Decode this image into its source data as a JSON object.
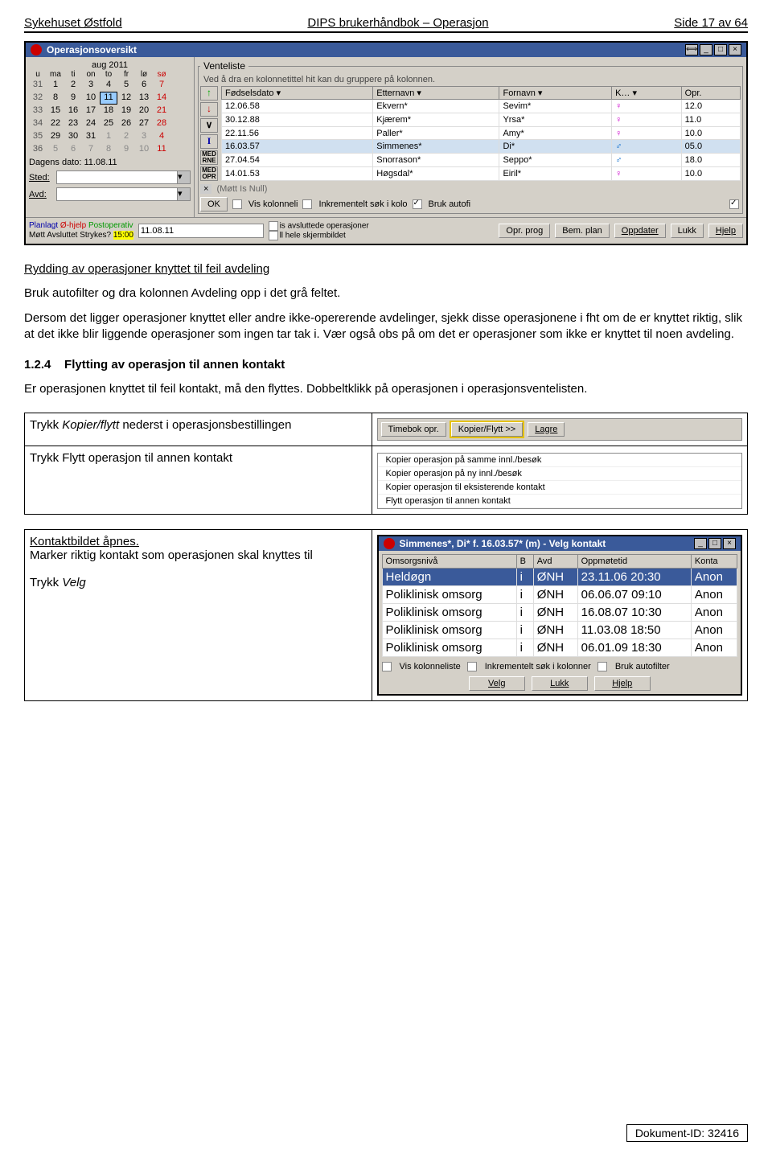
{
  "header": {
    "left": "Sykehuset Østfold",
    "center": "DIPS brukerhåndbok – Operasjon",
    "right": "Side 17 av 64"
  },
  "window1": {
    "title": "Operasjonsoversikt",
    "calendar": {
      "month": "aug 2011",
      "days": [
        "u",
        "ma",
        "ti",
        "on",
        "to",
        "fr",
        "lø",
        "sø"
      ],
      "weeks": [
        {
          "wk": "31",
          "d": [
            "1",
            "2",
            "3",
            "4",
            "5",
            "6"
          ],
          "sun": "7"
        },
        {
          "wk": "32",
          "d": [
            "8",
            "9",
            "10",
            "11",
            "12",
            "13"
          ],
          "sun": "14",
          "sel": 3
        },
        {
          "wk": "33",
          "d": [
            "15",
            "16",
            "17",
            "18",
            "19",
            "20"
          ],
          "sun": "21"
        },
        {
          "wk": "34",
          "d": [
            "22",
            "23",
            "24",
            "25",
            "26",
            "27"
          ],
          "sun": "28"
        },
        {
          "wk": "35",
          "d": [
            "29",
            "30",
            "31",
            "1",
            "2",
            "3"
          ],
          "sun": "4"
        },
        {
          "wk": "36",
          "d": [
            "5",
            "6",
            "7",
            "8",
            "9",
            "10"
          ],
          "sun": "11"
        }
      ],
      "today": "Dagens dato: 11.08.11"
    },
    "sted": "Sted:",
    "avd": "Avd:",
    "venteliste": {
      "title": "Venteliste",
      "grouptext": "Ved å dra en kolonnetittel hit kan du gruppere på kolonnen.",
      "cols": [
        "Fødselsdato",
        "Etternavn",
        "Fornavn",
        "K…",
        "Opr."
      ],
      "rows": [
        {
          "d": "12.06.58",
          "e": "Ekvern*",
          "f": "Sevim*",
          "g": "♀",
          "o": "12.0"
        },
        {
          "d": "30.12.88",
          "e": "Kjærem*",
          "f": "Yrsa*",
          "g": "♀",
          "o": "11.0"
        },
        {
          "d": "22.11.56",
          "e": "Paller*",
          "f": "Amy*",
          "g": "♀",
          "o": "10.0"
        },
        {
          "d": "16.03.57",
          "e": "Simmenes*",
          "f": "Di*",
          "g": "♂",
          "o": "05.0",
          "hl": true
        },
        {
          "d": "27.04.54",
          "e": "Snorrason*",
          "f": "Seppo*",
          "g": "♂",
          "o": "18.0"
        },
        {
          "d": "14.01.53",
          "e": "Høgsdal*",
          "f": "Eiril*",
          "g": "♀",
          "o": "10.0"
        }
      ],
      "filter": "(Møtt Is Null)",
      "ok": "OK",
      "vis": "Vis kolonneli",
      "inkr": "Inkrementelt søk i kolo",
      "bruk": "Bruk autofi"
    },
    "legend": {
      "line1a": "Planlagt",
      "line1b": "Ø-hjelp",
      "line1c": "Postoperativ",
      "line2a": "Møtt",
      "line2b": "Avsluttet",
      "line2c": "Strykes?",
      "time": "15:00",
      "date": "11.08.11",
      "chk1": "is avsluttede operasjoner",
      "chk2": "ll hele skjermbildet"
    },
    "buttons": [
      "Opr. prog",
      "Bem. plan",
      "Oppdater",
      "Lukk",
      "Hjelp"
    ]
  },
  "para1": {
    "title": "Rydding av operasjoner knyttet til feil avdeling",
    "p1": "Bruk autofilter og dra kolonnen Avdeling opp i det grå feltet.",
    "p2": "Dersom det ligger operasjoner knyttet eller andre ikke-opererende avdelinger, sjekk disse operasjonene i fht om de er knyttet riktig, slik at det ikke blir liggende operasjoner som ingen tar tak i. Vær også obs på om det er operasjoner som ikke er knyttet til noen avdeling."
  },
  "section": {
    "num": "1.2.4",
    "title": "Flytting av operasjon til annen kontakt",
    "p": "Er operasjonen knyttet til feil kontakt, må den flyttes. Dobbeltklikk på operasjonen i operasjonsventelisten."
  },
  "instr": {
    "row1_left": "Trykk Kopier/flytt nederst i operasjonsbestillingen",
    "row1_btns": [
      "Timebok opr.",
      "Kopier/Flytt >>",
      "Lagre"
    ],
    "row2_left": "Trykk Flytt operasjon til annen kontakt",
    "row2_menu": [
      "Kopier operasjon på samme innl./besøk",
      "Kopier operasjon på ny innl./besøk",
      "Kopier operasjon til eksisterende kontakt",
      "Flytt operasjon til annen kontakt"
    ]
  },
  "instr2": {
    "left_l1": "Kontaktbildet åpnes.",
    "left_l2": "Marker riktig kontakt som operasjonen skal knyttes til",
    "left_l3": "Trykk Velg",
    "win_title": "Simmenes*, Di* f. 16.03.57* (m) - Velg kontakt",
    "cols": [
      "Omsorgsnivå",
      "B",
      "Avd",
      "Oppmøtetid",
      "Konta"
    ],
    "rows": [
      {
        "o": "Heldøgn",
        "b": "i",
        "a": "ØNH",
        "t": "23.11.06 20:30",
        "k": "Anon",
        "sel": true
      },
      {
        "o": "Poliklinisk omsorg",
        "b": "i",
        "a": "ØNH",
        "t": "06.06.07 09:10",
        "k": "Anon"
      },
      {
        "o": "Poliklinisk omsorg",
        "b": "i",
        "a": "ØNH",
        "t": "16.08.07 10:30",
        "k": "Anon"
      },
      {
        "o": "Poliklinisk omsorg",
        "b": "i",
        "a": "ØNH",
        "t": "11.03.08 18:50",
        "k": "Anon"
      },
      {
        "o": "Poliklinisk omsorg",
        "b": "i",
        "a": "ØNH",
        "t": "06.01.09 18:30",
        "k": "Anon"
      }
    ],
    "vis": "Vis kolonneliste",
    "inkr": "Inkrementelt søk i kolonner",
    "bruk": "Bruk autofilter",
    "btns": [
      "Velg",
      "Lukk",
      "Hjelp"
    ]
  },
  "footer": "Dokument-ID: 32416"
}
